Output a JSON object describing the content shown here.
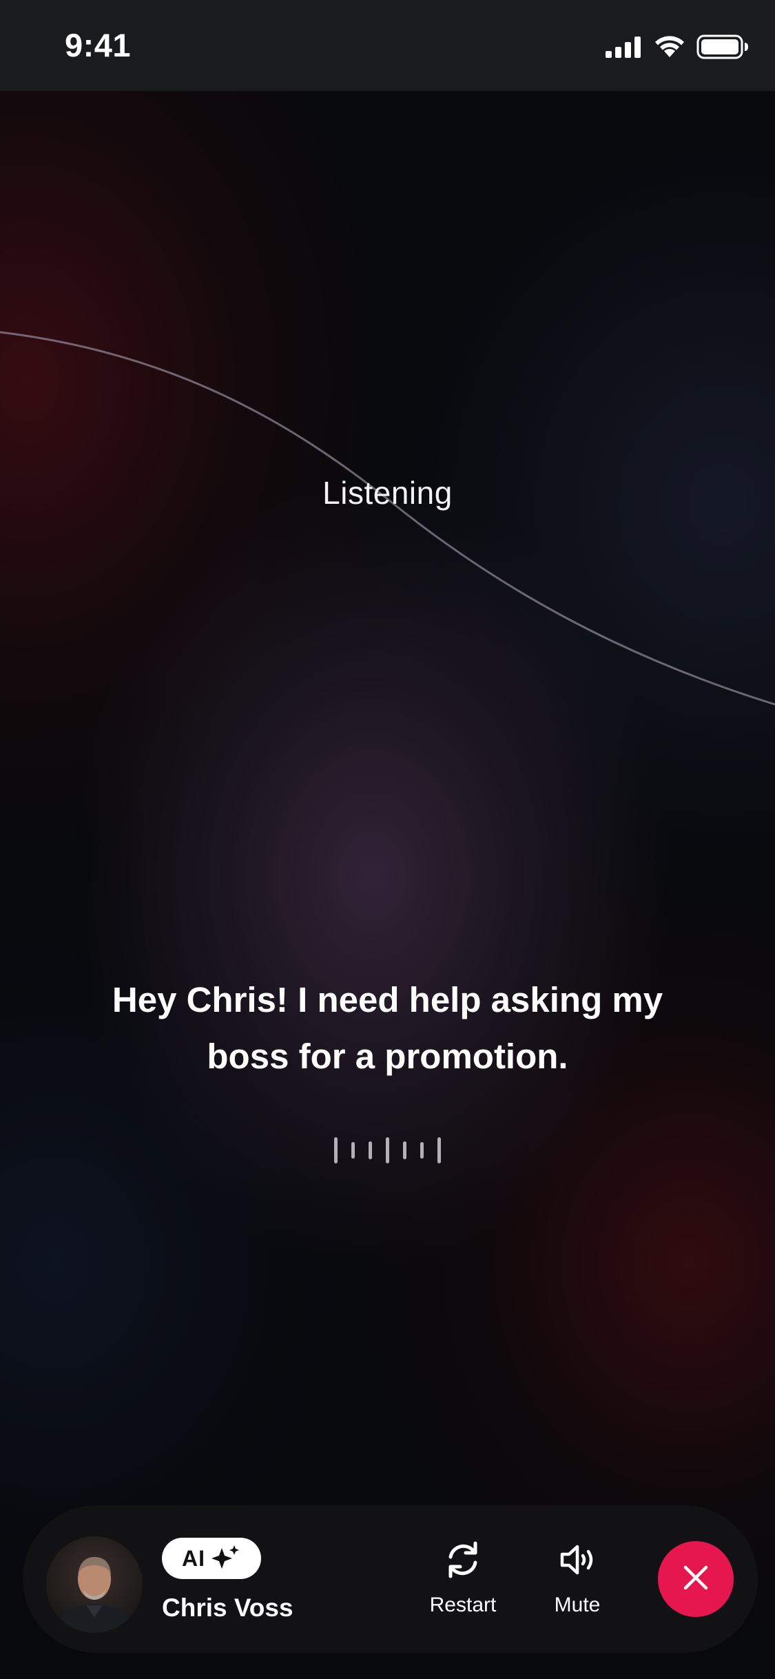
{
  "status_bar": {
    "time": "9:41",
    "icons": [
      "cellular-signal-icon",
      "wifi-icon",
      "battery-icon"
    ]
  },
  "state_label": "Listening",
  "transcript": "Hey Chris! I need help asking my boss for a promotion.",
  "voice_level_bars": [
    0.8,
    0.5,
    0.55,
    0.8,
    0.55,
    0.5,
    0.8
  ],
  "host": {
    "badge_text": "AI",
    "badge_icon": "sparkle-icon",
    "name": "Chris Voss"
  },
  "controls": {
    "restart_label": "Restart",
    "restart_icon": "refresh-icon",
    "mute_label": "Mute",
    "mute_icon": "speaker-icon",
    "end_icon": "close-icon"
  },
  "colors": {
    "end_call": "#e5174e",
    "control_bar": "#121214"
  }
}
